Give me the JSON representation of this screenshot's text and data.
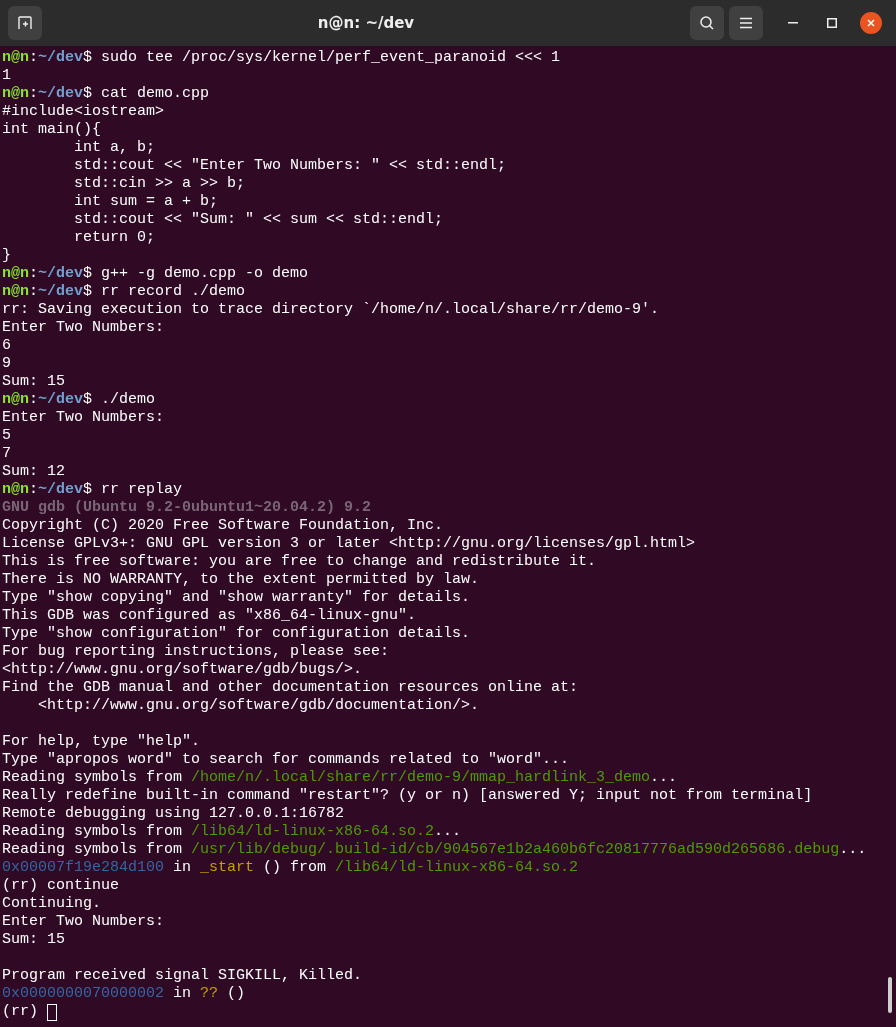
{
  "window": {
    "title": "n@n: ~/dev"
  },
  "lines": [
    {
      "segments": [
        {
          "kind": "user",
          "text": "n@n"
        },
        {
          "kind": "plain",
          "text": ":"
        },
        {
          "kind": "path",
          "text": "~/dev"
        },
        {
          "kind": "plain",
          "text": "$ sudo tee /proc/sys/kernel/perf_event_paranoid <<< 1"
        }
      ]
    },
    {
      "segments": [
        {
          "kind": "plain",
          "text": "1"
        }
      ]
    },
    {
      "segments": [
        {
          "kind": "user",
          "text": "n@n"
        },
        {
          "kind": "plain",
          "text": ":"
        },
        {
          "kind": "path",
          "text": "~/dev"
        },
        {
          "kind": "plain",
          "text": "$ cat demo.cpp"
        }
      ]
    },
    {
      "segments": [
        {
          "kind": "plain",
          "text": "#include<iostream>"
        }
      ]
    },
    {
      "segments": [
        {
          "kind": "plain",
          "text": "int main(){"
        }
      ]
    },
    {
      "segments": [
        {
          "kind": "plain",
          "text": "        int a, b;"
        }
      ]
    },
    {
      "segments": [
        {
          "kind": "plain",
          "text": "        std::cout << \"Enter Two Numbers: \" << std::endl;"
        }
      ]
    },
    {
      "segments": [
        {
          "kind": "plain",
          "text": "        std::cin >> a >> b;"
        }
      ]
    },
    {
      "segments": [
        {
          "kind": "plain",
          "text": "        int sum = a + b;"
        }
      ]
    },
    {
      "segments": [
        {
          "kind": "plain",
          "text": "        std::cout << \"Sum: \" << sum << std::endl;"
        }
      ]
    },
    {
      "segments": [
        {
          "kind": "plain",
          "text": "        return 0;"
        }
      ]
    },
    {
      "segments": [
        {
          "kind": "plain",
          "text": "}"
        }
      ]
    },
    {
      "segments": [
        {
          "kind": "user",
          "text": "n@n"
        },
        {
          "kind": "plain",
          "text": ":"
        },
        {
          "kind": "path",
          "text": "~/dev"
        },
        {
          "kind": "plain",
          "text": "$ g++ -g demo.cpp -o demo"
        }
      ]
    },
    {
      "segments": [
        {
          "kind": "user",
          "text": "n@n"
        },
        {
          "kind": "plain",
          "text": ":"
        },
        {
          "kind": "path",
          "text": "~/dev"
        },
        {
          "kind": "plain",
          "text": "$ rr record ./demo"
        }
      ]
    },
    {
      "segments": [
        {
          "kind": "plain",
          "text": "rr: Saving execution to trace directory `/home/n/.local/share/rr/demo-9'."
        }
      ]
    },
    {
      "segments": [
        {
          "kind": "plain",
          "text": "Enter Two Numbers:"
        }
      ]
    },
    {
      "segments": [
        {
          "kind": "plain",
          "text": "6"
        }
      ]
    },
    {
      "segments": [
        {
          "kind": "plain",
          "text": "9"
        }
      ]
    },
    {
      "segments": [
        {
          "kind": "plain",
          "text": "Sum: 15"
        }
      ]
    },
    {
      "segments": [
        {
          "kind": "user",
          "text": "n@n"
        },
        {
          "kind": "plain",
          "text": ":"
        },
        {
          "kind": "path",
          "text": "~/dev"
        },
        {
          "kind": "plain",
          "text": "$ ./demo"
        }
      ]
    },
    {
      "segments": [
        {
          "kind": "plain",
          "text": "Enter Two Numbers:"
        }
      ]
    },
    {
      "segments": [
        {
          "kind": "plain",
          "text": "5"
        }
      ]
    },
    {
      "segments": [
        {
          "kind": "plain",
          "text": "7"
        }
      ]
    },
    {
      "segments": [
        {
          "kind": "plain",
          "text": "Sum: 12"
        }
      ]
    },
    {
      "segments": [
        {
          "kind": "user",
          "text": "n@n"
        },
        {
          "kind": "plain",
          "text": ":"
        },
        {
          "kind": "path",
          "text": "~/dev"
        },
        {
          "kind": "plain",
          "text": "$ rr replay"
        }
      ]
    },
    {
      "segments": [
        {
          "kind": "dim",
          "text": "GNU gdb (Ubuntu 9.2-0ubuntu1~20.04.2) 9.2"
        }
      ]
    },
    {
      "segments": [
        {
          "kind": "plain",
          "text": "Copyright (C) 2020 Free Software Foundation, Inc."
        }
      ]
    },
    {
      "segments": [
        {
          "kind": "plain",
          "text": "License GPLv3+: GNU GPL version 3 or later <http://gnu.org/licenses/gpl.html>"
        }
      ]
    },
    {
      "segments": [
        {
          "kind": "plain",
          "text": "This is free software: you are free to change and redistribute it."
        }
      ]
    },
    {
      "segments": [
        {
          "kind": "plain",
          "text": "There is NO WARRANTY, to the extent permitted by law."
        }
      ]
    },
    {
      "segments": [
        {
          "kind": "plain",
          "text": "Type \"show copying\" and \"show warranty\" for details."
        }
      ]
    },
    {
      "segments": [
        {
          "kind": "plain",
          "text": "This GDB was configured as \"x86_64-linux-gnu\"."
        }
      ]
    },
    {
      "segments": [
        {
          "kind": "plain",
          "text": "Type \"show configuration\" for configuration details."
        }
      ]
    },
    {
      "segments": [
        {
          "kind": "plain",
          "text": "For bug reporting instructions, please see:"
        }
      ]
    },
    {
      "segments": [
        {
          "kind": "plain",
          "text": "<http://www.gnu.org/software/gdb/bugs/>."
        }
      ]
    },
    {
      "segments": [
        {
          "kind": "plain",
          "text": "Find the GDB manual and other documentation resources online at:"
        }
      ]
    },
    {
      "segments": [
        {
          "kind": "plain",
          "text": "    <http://www.gnu.org/software/gdb/documentation/>."
        }
      ]
    },
    {
      "kind": "blank"
    },
    {
      "segments": [
        {
          "kind": "plain",
          "text": "For help, type \"help\"."
        }
      ]
    },
    {
      "segments": [
        {
          "kind": "plain",
          "text": "Type \"apropos word\" to search for commands related to \"word\"..."
        }
      ]
    },
    {
      "segments": [
        {
          "kind": "plain",
          "text": "Reading symbols from "
        },
        {
          "kind": "file",
          "text": "/home/n/.local/share/rr/demo-9/mmap_hardlink_3_demo"
        },
        {
          "kind": "plain",
          "text": "..."
        }
      ]
    },
    {
      "segments": [
        {
          "kind": "plain",
          "text": "Really redefine built-in command \"restart\"? (y or n) [answered Y; input not from terminal]"
        }
      ]
    },
    {
      "segments": [
        {
          "kind": "plain",
          "text": "Remote debugging using 127.0.0.1:16782"
        }
      ]
    },
    {
      "segments": [
        {
          "kind": "plain",
          "text": "Reading symbols from "
        },
        {
          "kind": "file",
          "text": "/lib64/ld-linux-x86-64.so.2"
        },
        {
          "kind": "plain",
          "text": "..."
        }
      ]
    },
    {
      "segments": [
        {
          "kind": "plain",
          "text": "Reading symbols from "
        },
        {
          "kind": "file",
          "text": "/usr/lib/debug/.build-id/cb/904567e1b2a460b6fc20817776ad590d265686.debug"
        },
        {
          "kind": "plain",
          "text": "..."
        }
      ]
    },
    {
      "segments": [
        {
          "kind": "address",
          "text": "0x00007f19e284d100"
        },
        {
          "kind": "plain",
          "text": " in "
        },
        {
          "kind": "function",
          "text": "_start"
        },
        {
          "kind": "plain",
          "text": " () from "
        },
        {
          "kind": "file",
          "text": "/lib64/ld-linux-x86-64.so.2"
        }
      ]
    },
    {
      "segments": [
        {
          "kind": "plain",
          "text": "(rr) continue"
        }
      ]
    },
    {
      "segments": [
        {
          "kind": "plain",
          "text": "Continuing."
        }
      ]
    },
    {
      "segments": [
        {
          "kind": "plain",
          "text": "Enter Two Numbers:"
        }
      ]
    },
    {
      "segments": [
        {
          "kind": "plain",
          "text": "Sum: 15"
        }
      ]
    },
    {
      "kind": "blank"
    },
    {
      "segments": [
        {
          "kind": "plain",
          "text": "Program received signal SIGKILL, Killed."
        }
      ]
    },
    {
      "segments": [
        {
          "kind": "address",
          "text": "0x0000000070000002"
        },
        {
          "kind": "plain",
          "text": " in "
        },
        {
          "kind": "function",
          "text": "??"
        },
        {
          "kind": "plain",
          "text": " ()"
        }
      ]
    },
    {
      "segments": [
        {
          "kind": "plain",
          "text": "(rr) "
        }
      ],
      "cursor": true
    }
  ]
}
